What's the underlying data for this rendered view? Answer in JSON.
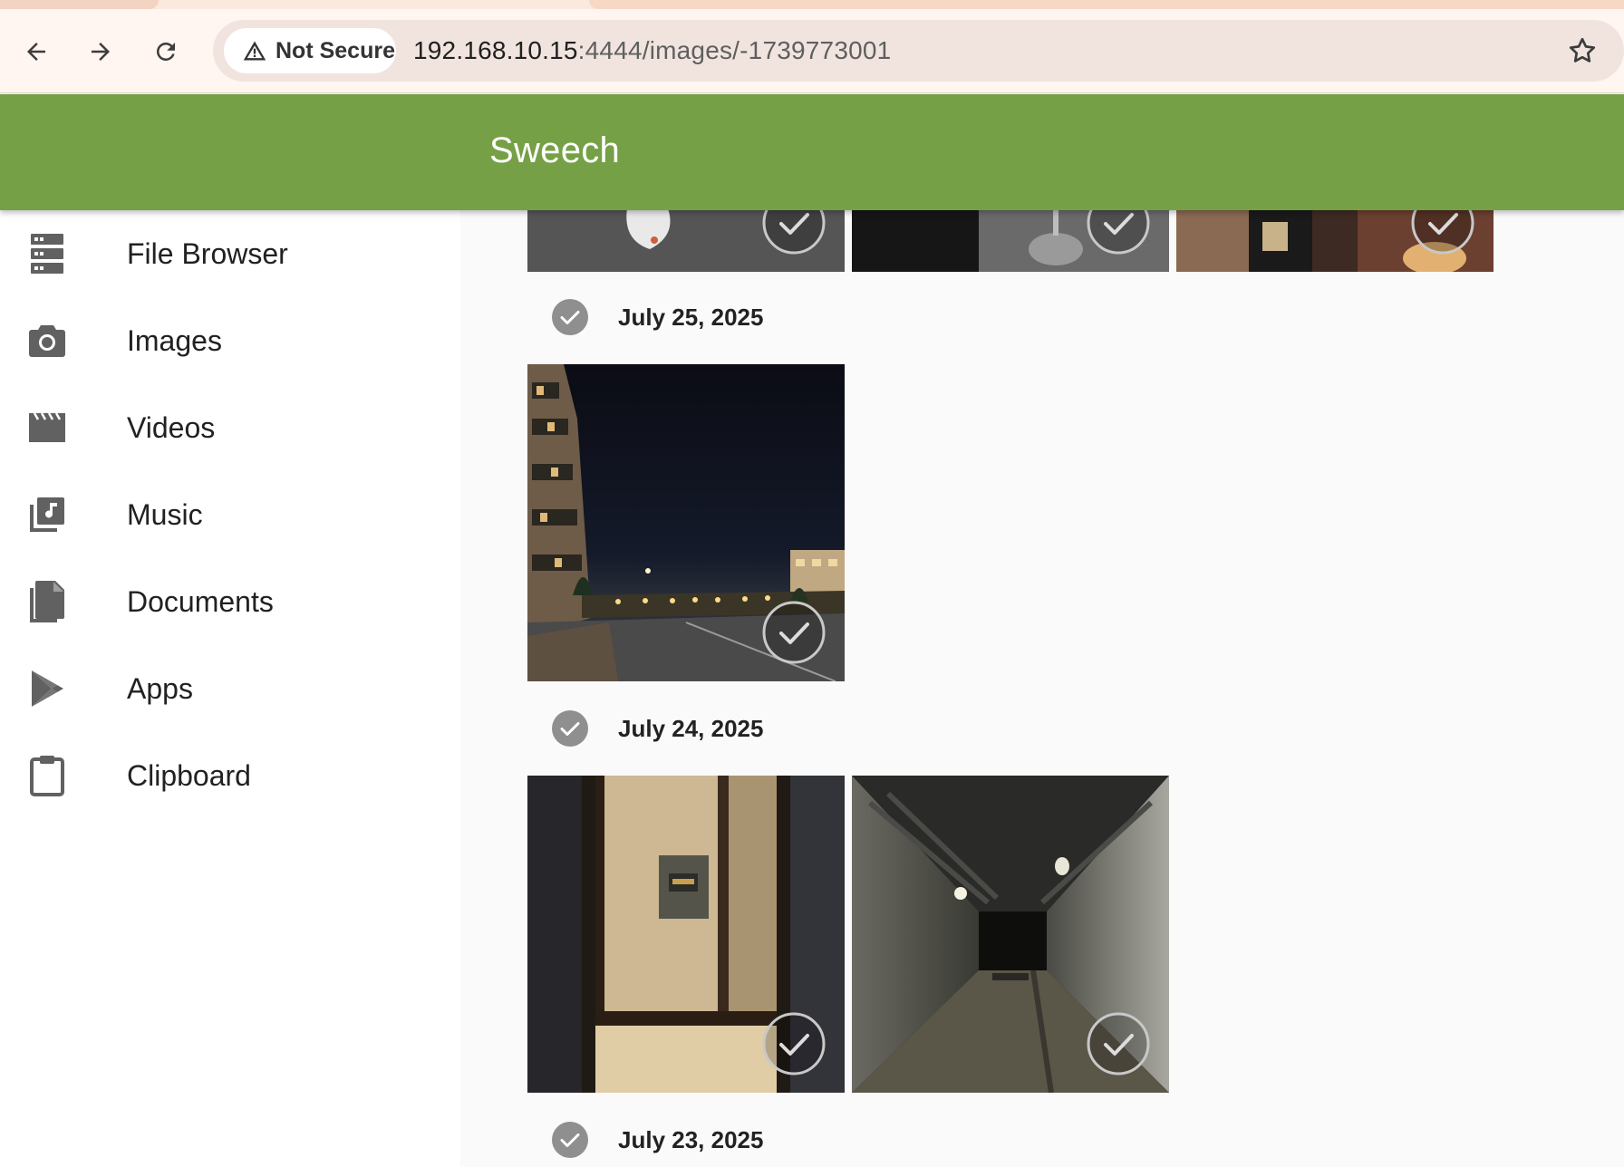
{
  "browser": {
    "security_label": "Not Secure",
    "url_host": "192.168.10.15",
    "url_path": ":4444/images/-1739773001"
  },
  "app": {
    "title": "Sweech",
    "accent_color": "#76a046"
  },
  "sidebar": {
    "items": [
      {
        "label": "File Browser",
        "icon": "storage-icon"
      },
      {
        "label": "Images",
        "icon": "camera-icon"
      },
      {
        "label": "Videos",
        "icon": "clapperboard-icon"
      },
      {
        "label": "Music",
        "icon": "music-library-icon"
      },
      {
        "label": "Documents",
        "icon": "documents-icon"
      },
      {
        "label": "Apps",
        "icon": "play-store-icon"
      },
      {
        "label": "Clipboard",
        "icon": "clipboard-icon"
      }
    ]
  },
  "gallery": {
    "groups": [
      {
        "date": "July 25, 2025",
        "photo_count": 1
      },
      {
        "date": "July 24, 2025",
        "photo_count": 2
      },
      {
        "date": "July 23, 2025",
        "photo_count": 0
      }
    ]
  }
}
